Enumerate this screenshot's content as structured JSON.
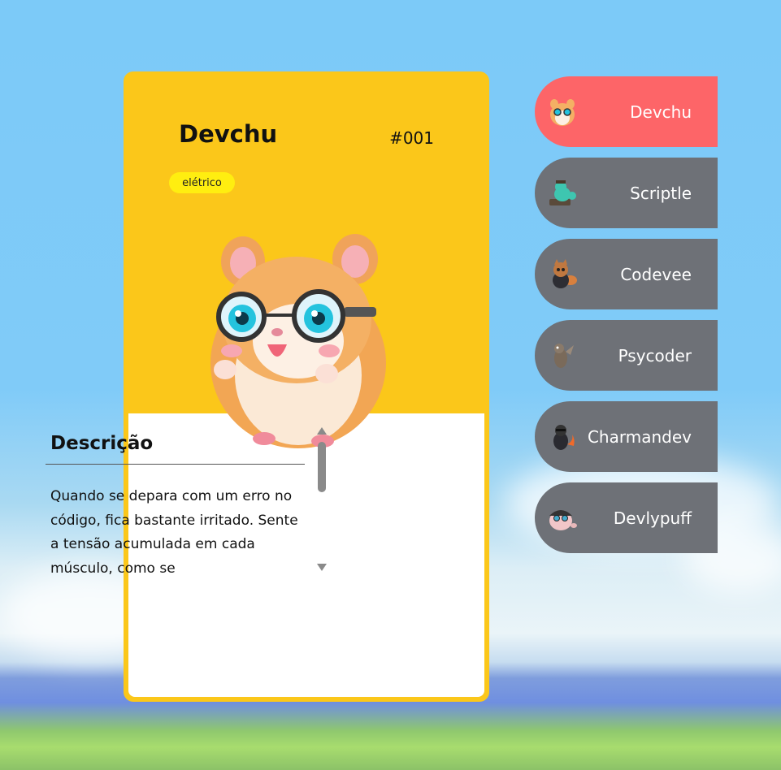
{
  "card": {
    "name": "Devchu",
    "number": "#001",
    "type": "elétrico",
    "description_title": "Descrição",
    "description": "Quando se depara com um erro no código, fica bastante irritado. Sente a tensão acumulada em cada músculo, como se"
  },
  "roster": [
    {
      "label": "Devchu",
      "active": true
    },
    {
      "label": "Scriptle",
      "active": false
    },
    {
      "label": "Codevee",
      "active": false
    },
    {
      "label": "Psycoder",
      "active": false
    },
    {
      "label": "Charmandev",
      "active": false
    },
    {
      "label": "Devlypuff",
      "active": false
    }
  ],
  "colors": {
    "card_bg": "#fbc71a",
    "badge_bg": "#ffee10",
    "active_item": "#fd6568",
    "inactive_item": "#6e7177",
    "sky": "#7ccaf8"
  },
  "icons": {
    "scroll_up": "triangle-up",
    "scroll_down": "triangle-down"
  }
}
